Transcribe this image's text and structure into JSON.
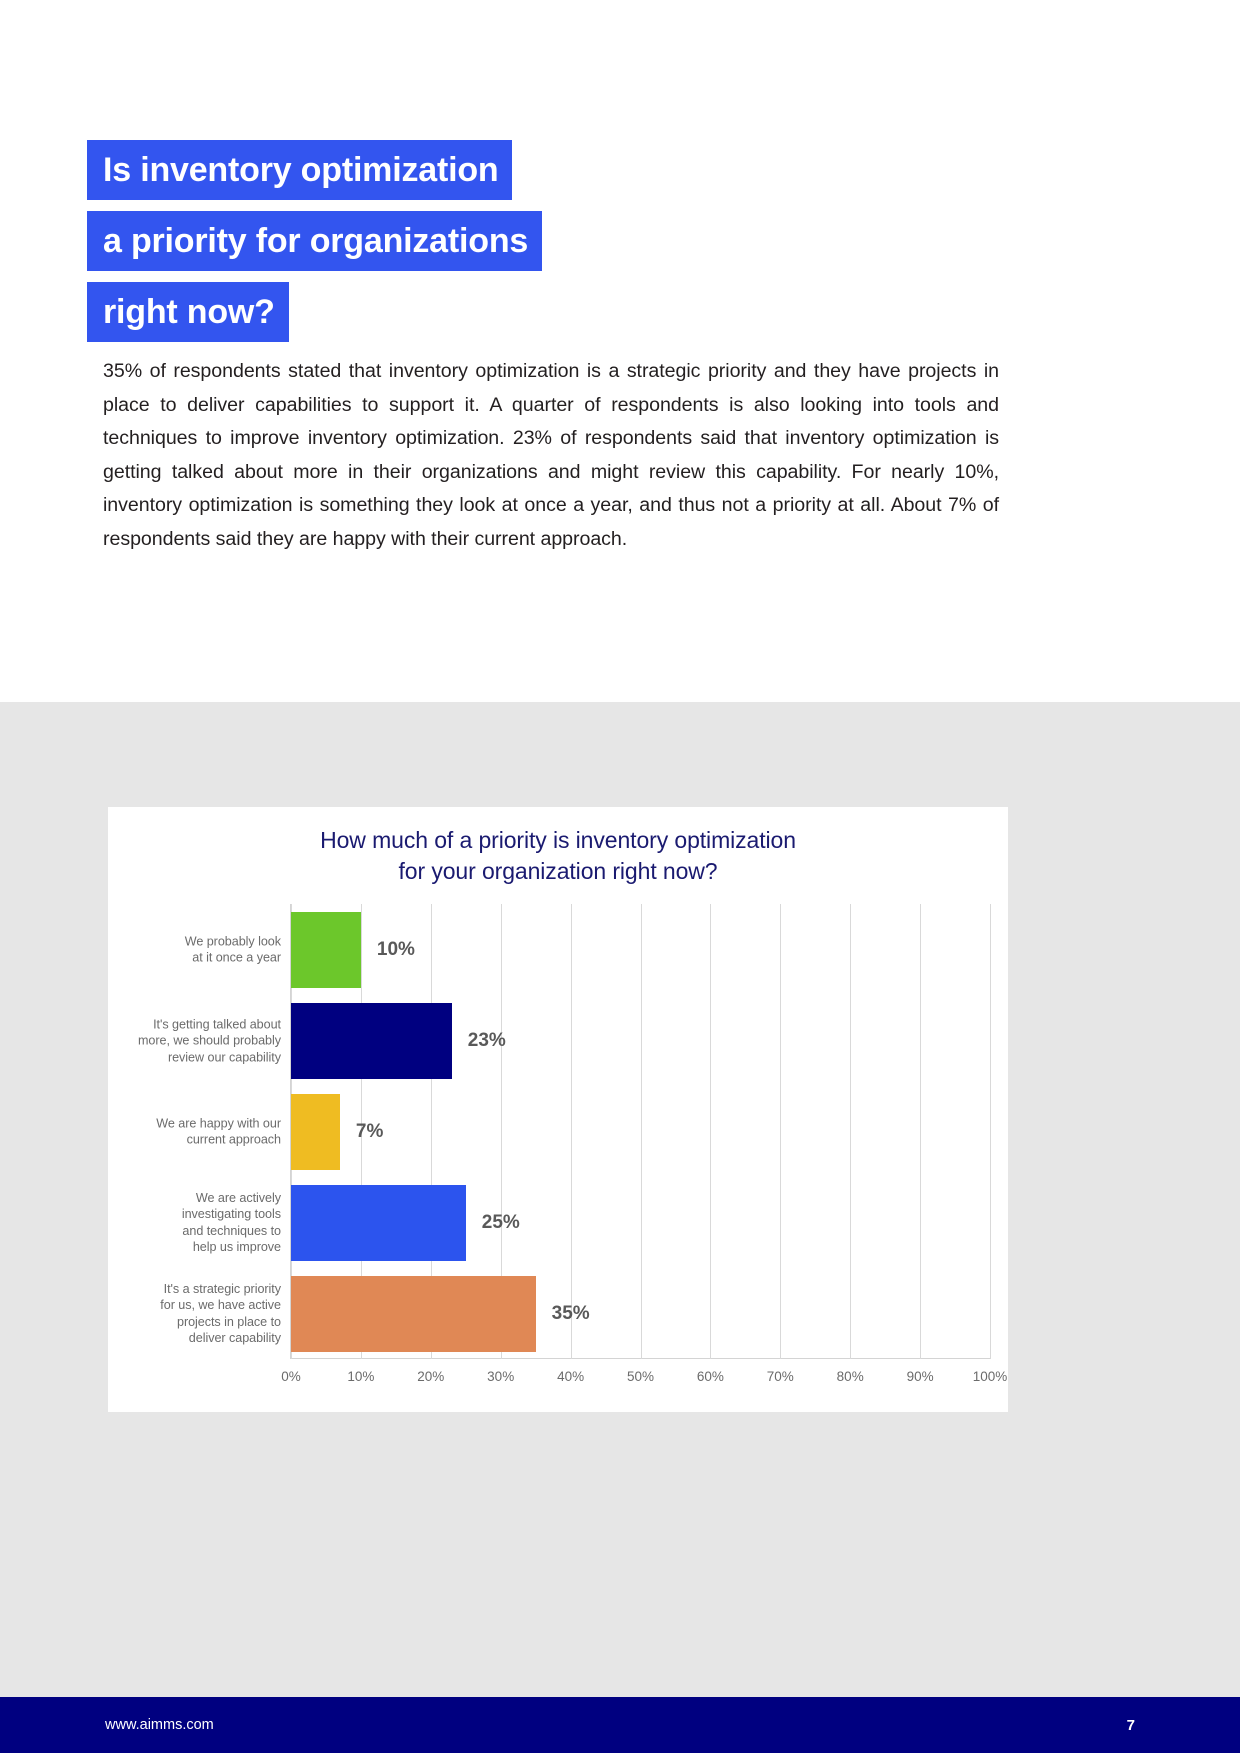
{
  "headline": {
    "lines": [
      "Is inventory optimization",
      "a priority for organizations",
      "right now?"
    ],
    "highlight_color": "#3355EF",
    "text_color": "#FFFFFF"
  },
  "body_copy": "35% of respondents stated that inventory optimization is a strategic priority and they have projects in place to deliver capabilities to support it. A quarter of respondents is also looking into tools and techniques to improve inventory optimization. 23% of respondents said that inventory optimization is getting talked about more in their organizations and might review this capability. For nearly 10%, inventory optimization is something they look at once a year, and thus not a priority at all. About 7% of respondents said they are happy with their current approach.",
  "chart_data": {
    "type": "bar",
    "orientation": "horizontal",
    "title": "How much of a priority is inventory optimization for your organization right now?",
    "title_line1": "How much of a priority is inventory optimization",
    "title_line2": "for your organization right now?",
    "title_color": "#1A1A70",
    "xlabel": "",
    "ylabel": "",
    "xlim": [
      0,
      100
    ],
    "grid": true,
    "legend": false,
    "xticks": [
      "0%",
      "10%",
      "20%",
      "30%",
      "40%",
      "50%",
      "60%",
      "70%",
      "80%",
      "90%",
      "100%"
    ],
    "xtick_values": [
      0,
      10,
      20,
      30,
      40,
      50,
      60,
      70,
      80,
      90,
      100
    ],
    "categories": [
      "We probably look at it once a year",
      "It's getting talked about more, we should probably review our capability",
      "We are happy with our current approach",
      "We are actively investigating tools and techniques to help us improve",
      "It's a strategic priority for us, we have active projects in place to deliver capability"
    ],
    "category_lines": [
      [
        "We probably look",
        "at it once a year"
      ],
      [
        "It's getting talked about",
        "more, we should probably",
        "review our capability"
      ],
      [
        "We are happy with our",
        "current approach"
      ],
      [
        "We are actively",
        "investigating tools",
        "and techniques to",
        "help us improve"
      ],
      [
        "It's a strategic priority",
        "for us, we have active",
        "projects in place to",
        "deliver capability"
      ]
    ],
    "values": [
      10,
      23,
      7,
      25,
      35
    ],
    "value_labels": [
      "10%",
      "23%",
      "7%",
      "25%",
      "35%"
    ],
    "colors": [
      "#6CC72B",
      "#000080",
      "#EFBC22",
      "#2C54EE",
      "#E08855"
    ]
  },
  "footer": {
    "url": "www.aimms.com",
    "page_number": "7",
    "background": "#000080"
  }
}
